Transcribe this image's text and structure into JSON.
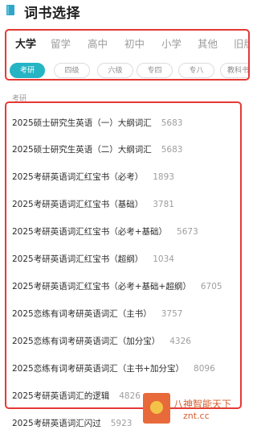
{
  "header": {
    "title": "词书选择",
    "icon": "book-icon"
  },
  "tabs": [
    {
      "label": "大学",
      "active": true
    },
    {
      "label": "留学",
      "active": false
    },
    {
      "label": "高中",
      "active": false
    },
    {
      "label": "初中",
      "active": false
    },
    {
      "label": "小学",
      "active": false
    },
    {
      "label": "其他",
      "active": false
    },
    {
      "label": "旧版",
      "active": false
    }
  ],
  "subtabs": [
    {
      "label": "考研",
      "active": true
    },
    {
      "label": "四级",
      "active": false
    },
    {
      "label": "六级",
      "active": false
    },
    {
      "label": "专四",
      "active": false
    },
    {
      "label": "专八",
      "active": false
    },
    {
      "label": "教科书",
      "active": false
    }
  ],
  "section_label": "考研",
  "books": [
    {
      "name": "2025硕士研究生英语（一）大纲词汇",
      "count": "5683"
    },
    {
      "name": "2025硕士研究生英语（二）大纲词汇",
      "count": "5683"
    },
    {
      "name": "2025考研英语词汇红宝书（必考）",
      "count": "1893"
    },
    {
      "name": "2025考研英语词汇红宝书（基础）",
      "count": "3781"
    },
    {
      "name": "2025考研英语词汇红宝书（必考+基础）",
      "count": "5673"
    },
    {
      "name": "2025考研英语词汇红宝书（超纲）",
      "count": "1034"
    },
    {
      "name": "2025考研英语词汇红宝书（必考+基础+超纲）",
      "count": "6705"
    },
    {
      "name": "2025恋练有词考研英语词汇（主书）",
      "count": "3757"
    },
    {
      "name": "2025恋练有词考研英语词汇（加分宝）",
      "count": "4326"
    },
    {
      "name": "2025恋练有词考研英语词汇（主书+加分宝）",
      "count": "8096"
    },
    {
      "name": "2025考研英语词汇的逻辑",
      "count": "4826"
    },
    {
      "name": "2025考研英语词汇闪过",
      "count": "5923"
    }
  ],
  "watermark": {
    "line1": "八神智能天下",
    "line2": "znt.cc"
  },
  "colors": {
    "accent": "#24b4c4",
    "highlight": "#e53935",
    "watermark": "#d35f2e"
  }
}
